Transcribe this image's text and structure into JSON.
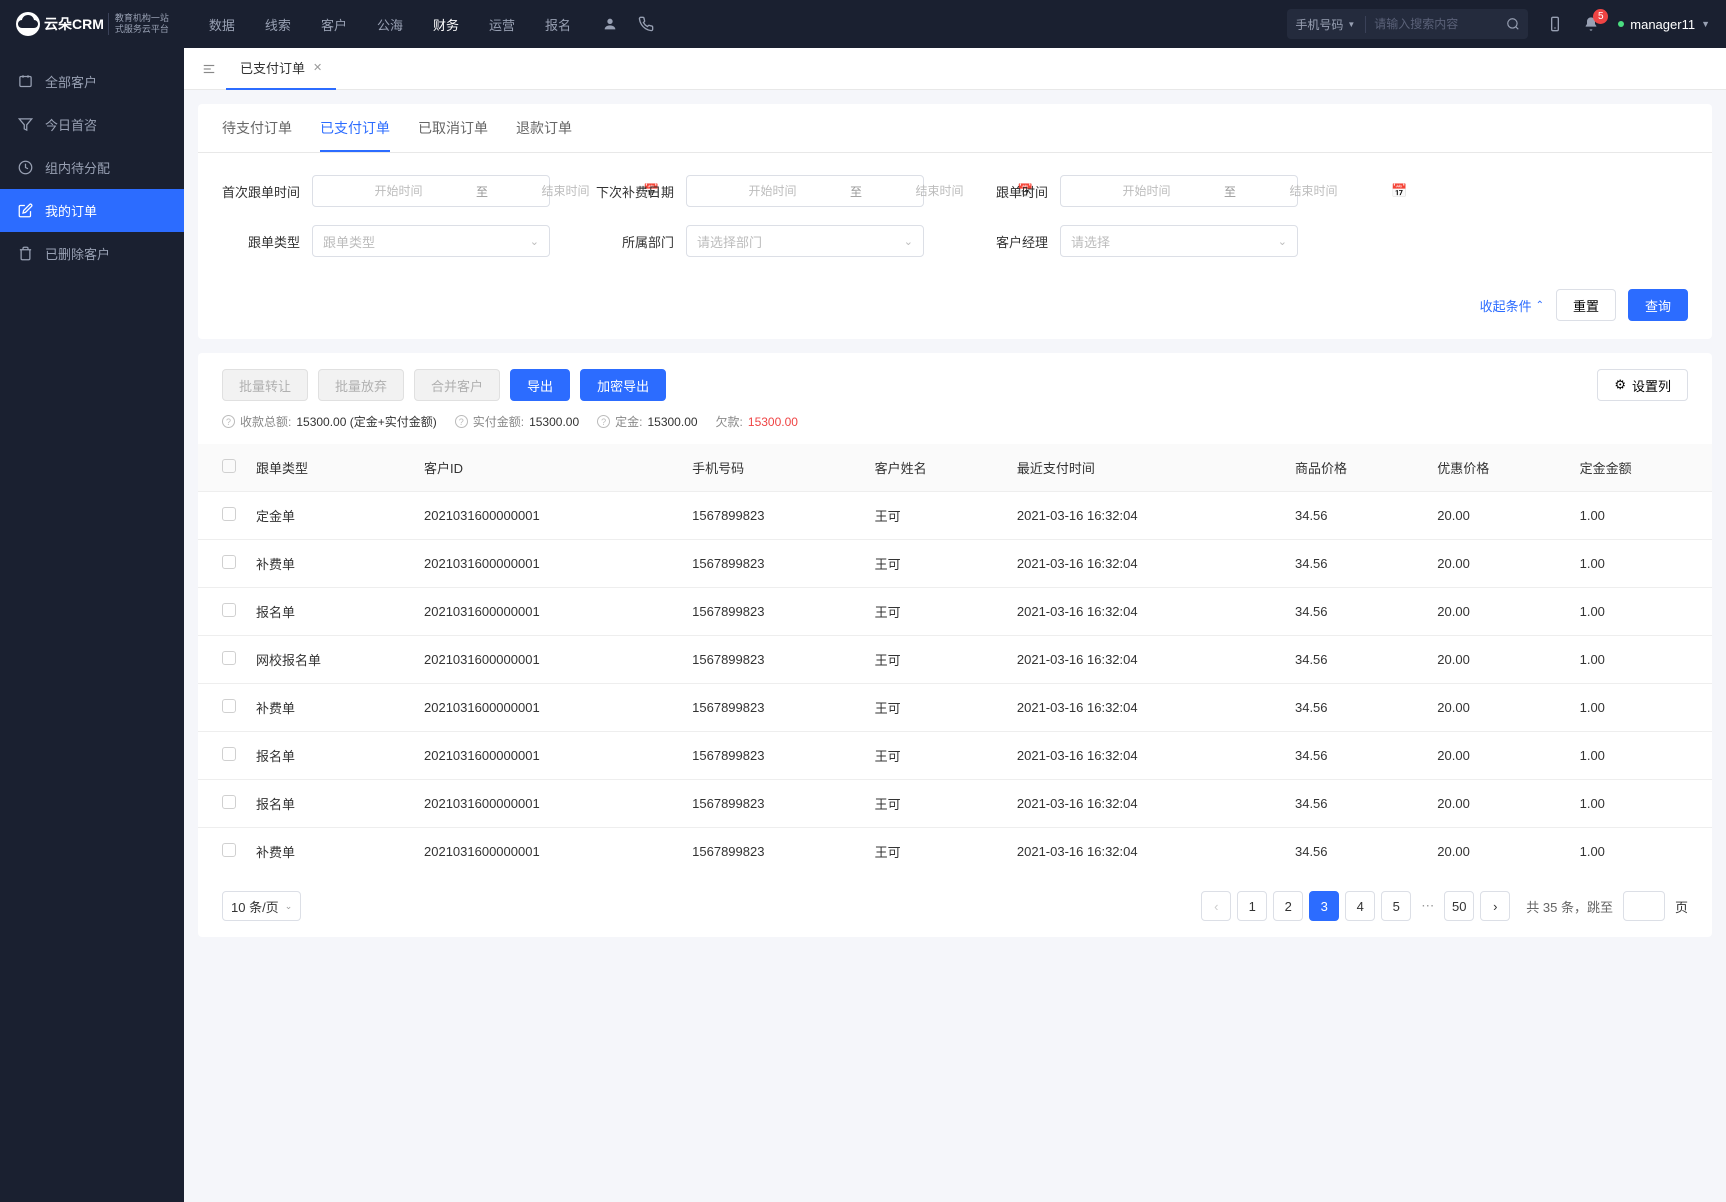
{
  "header": {
    "logo_text": "云朵CRM",
    "logo_sub1": "教育机构一站",
    "logo_sub2": "式服务云平台",
    "nav": [
      "数据",
      "线索",
      "客户",
      "公海",
      "财务",
      "运营",
      "报名"
    ],
    "nav_active": 4,
    "search_type": "手机号码",
    "search_placeholder": "请输入搜索内容",
    "notif_count": "5",
    "username": "manager11"
  },
  "sidebar": {
    "items": [
      {
        "label": "全部客户",
        "icon": "users"
      },
      {
        "label": "今日首咨",
        "icon": "filter"
      },
      {
        "label": "组内待分配",
        "icon": "clock"
      },
      {
        "label": "我的订单",
        "icon": "edit"
      },
      {
        "label": "已删除客户",
        "icon": "trash"
      }
    ],
    "active": 3
  },
  "page_tab": {
    "label": "已支付订单"
  },
  "inner_tabs": [
    "待支付订单",
    "已支付订单",
    "已取消订单",
    "退款订单"
  ],
  "inner_active": 1,
  "filters": {
    "first_follow": "首次跟单时间",
    "next_supp": "下次补费日期",
    "follow_time": "跟单时间",
    "follow_type": "跟单类型",
    "follow_type_ph": "跟单类型",
    "dept": "所属部门",
    "dept_ph": "请选择部门",
    "manager": "客户经理",
    "manager_ph": "请选择",
    "start_ph": "开始时间",
    "end_ph": "结束时间",
    "sep": "至",
    "collapse": "收起条件",
    "reset": "重置",
    "query": "查询"
  },
  "toolbar": {
    "batch_transfer": "批量转让",
    "batch_abandon": "批量放弃",
    "merge": "合并客户",
    "export": "导出",
    "export_enc": "加密导出",
    "cols": "设置列"
  },
  "summary": {
    "total_label": "收款总额:",
    "total_val": "15300.00 (定金+实付金额)",
    "paid_label": "实付金额:",
    "paid_val": "15300.00",
    "deposit_label": "定金:",
    "deposit_val": "15300.00",
    "debt_label": "欠款:",
    "debt_val": "15300.00"
  },
  "table": {
    "cols": [
      "跟单类型",
      "客户ID",
      "手机号码",
      "客户姓名",
      "最近支付时间",
      "商品价格",
      "优惠价格",
      "定金金额"
    ],
    "rows": [
      {
        "type": "定金单",
        "cid": "2021031600000001",
        "phone": "1567899823",
        "name": "王可",
        "time": "2021-03-16 16:32:04",
        "price": "34.56",
        "disc": "20.00",
        "deposit": "1.00"
      },
      {
        "type": "补费单",
        "cid": "2021031600000001",
        "phone": "1567899823",
        "name": "王可",
        "time": "2021-03-16 16:32:04",
        "price": "34.56",
        "disc": "20.00",
        "deposit": "1.00"
      },
      {
        "type": "报名单",
        "cid": "2021031600000001",
        "phone": "1567899823",
        "name": "王可",
        "time": "2021-03-16 16:32:04",
        "price": "34.56",
        "disc": "20.00",
        "deposit": "1.00"
      },
      {
        "type": "网校报名单",
        "cid": "2021031600000001",
        "phone": "1567899823",
        "name": "王可",
        "time": "2021-03-16 16:32:04",
        "price": "34.56",
        "disc": "20.00",
        "deposit": "1.00"
      },
      {
        "type": "补费单",
        "cid": "2021031600000001",
        "phone": "1567899823",
        "name": "王可",
        "time": "2021-03-16 16:32:04",
        "price": "34.56",
        "disc": "20.00",
        "deposit": "1.00"
      },
      {
        "type": "报名单",
        "cid": "2021031600000001",
        "phone": "1567899823",
        "name": "王可",
        "time": "2021-03-16 16:32:04",
        "price": "34.56",
        "disc": "20.00",
        "deposit": "1.00"
      },
      {
        "type": "报名单",
        "cid": "2021031600000001",
        "phone": "1567899823",
        "name": "王可",
        "time": "2021-03-16 16:32:04",
        "price": "34.56",
        "disc": "20.00",
        "deposit": "1.00"
      },
      {
        "type": "补费单",
        "cid": "2021031600000001",
        "phone": "1567899823",
        "name": "王可",
        "time": "2021-03-16 16:32:04",
        "price": "34.56",
        "disc": "20.00",
        "deposit": "1.00"
      }
    ]
  },
  "pagination": {
    "page_size": "10 条/页",
    "pages": [
      "1",
      "2",
      "3",
      "4",
      "5"
    ],
    "active": "3",
    "last": "50",
    "total_prefix": "共",
    "total_count": "35",
    "total_suffix": "条，跳至",
    "page_suffix": "页"
  }
}
